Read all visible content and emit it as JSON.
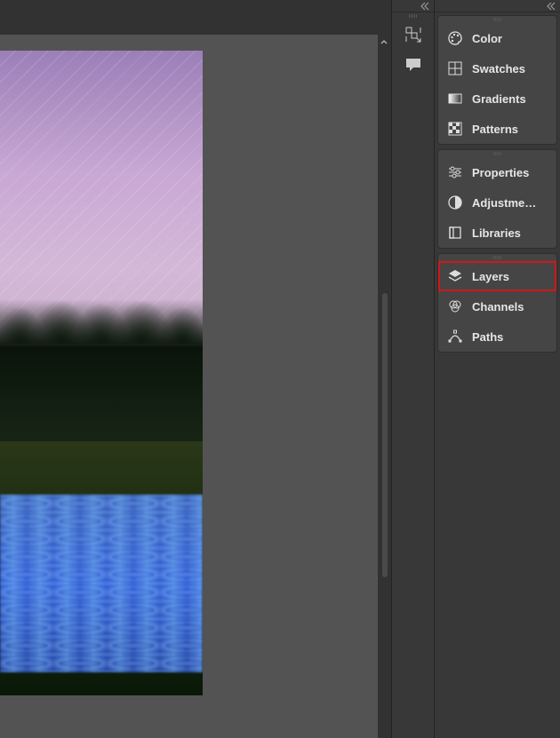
{
  "dock": {
    "icons": [
      "history-icon",
      "comment-icon"
    ]
  },
  "panels": {
    "group1": [
      {
        "icon": "color-icon",
        "label": "Color"
      },
      {
        "icon": "swatches-icon",
        "label": "Swatches"
      },
      {
        "icon": "gradients-icon",
        "label": "Gradients"
      },
      {
        "icon": "patterns-icon",
        "label": "Patterns"
      }
    ],
    "group2": [
      {
        "icon": "properties-icon",
        "label": "Properties"
      },
      {
        "icon": "adjustments-icon",
        "label": "Adjustme…"
      },
      {
        "icon": "libraries-icon",
        "label": "Libraries"
      }
    ],
    "group3": [
      {
        "icon": "layers-icon",
        "label": "Layers",
        "highlighted": true
      },
      {
        "icon": "channels-icon",
        "label": "Channels"
      },
      {
        "icon": "paths-icon",
        "label": "Paths"
      }
    ]
  },
  "colors": {
    "highlight": "#d01818"
  }
}
